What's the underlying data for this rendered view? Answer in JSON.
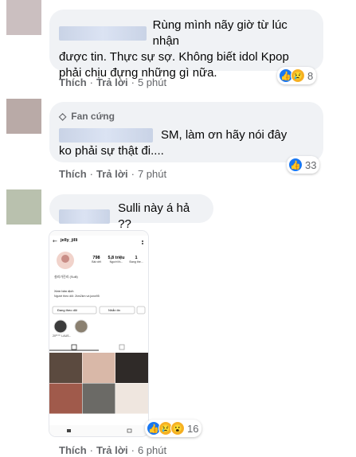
{
  "comments": [
    {
      "text_line1": "Rùng mình nãy giờ từ lúc nhận",
      "text_line2": "được tin. Thực sự sợ. Không biết idol Kpop",
      "text_line3": "phải chịu đựng những gì nữa.",
      "like_label": "Thích",
      "reply_label": "Trả lời",
      "time": "5 phút",
      "reaction_count": "8"
    },
    {
      "badge": "Fan cứng",
      "text_line1": "SM, làm ơn hãy nói đây",
      "text_line2": "ko phải sự thật đi....",
      "like_label": "Thích",
      "reply_label": "Trả lời",
      "time": "7 phút",
      "reaction_count": "33"
    },
    {
      "text_line1": "Sulli này á hả ??",
      "like_label": "Thích",
      "reply_label": "Trả lời",
      "time": "6 phút",
      "reaction_count": "16"
    }
  ],
  "phone": {
    "username": "jelly_jilli",
    "stats": [
      {
        "value": "798",
        "label": "Bài viết"
      },
      {
        "value": "5,8 triệu",
        "label": "Người th..."
      },
      {
        "value": "1",
        "label": "Đang the..."
      }
    ],
    "bio": "설리가진리 (Sulli)",
    "see_translation": "Xem bản dịch",
    "followed_by": "Người theo dõi: 2km2km và junw95",
    "follow_button": "Đang theo dõi",
    "message_button": "Nhắn tin",
    "highlight_label": "20ᄃᄃ LAUS..."
  },
  "icons": {
    "like": "like-icon",
    "sad": "sad-icon",
    "wow": "wow-icon",
    "diamond": "diamond-icon"
  }
}
